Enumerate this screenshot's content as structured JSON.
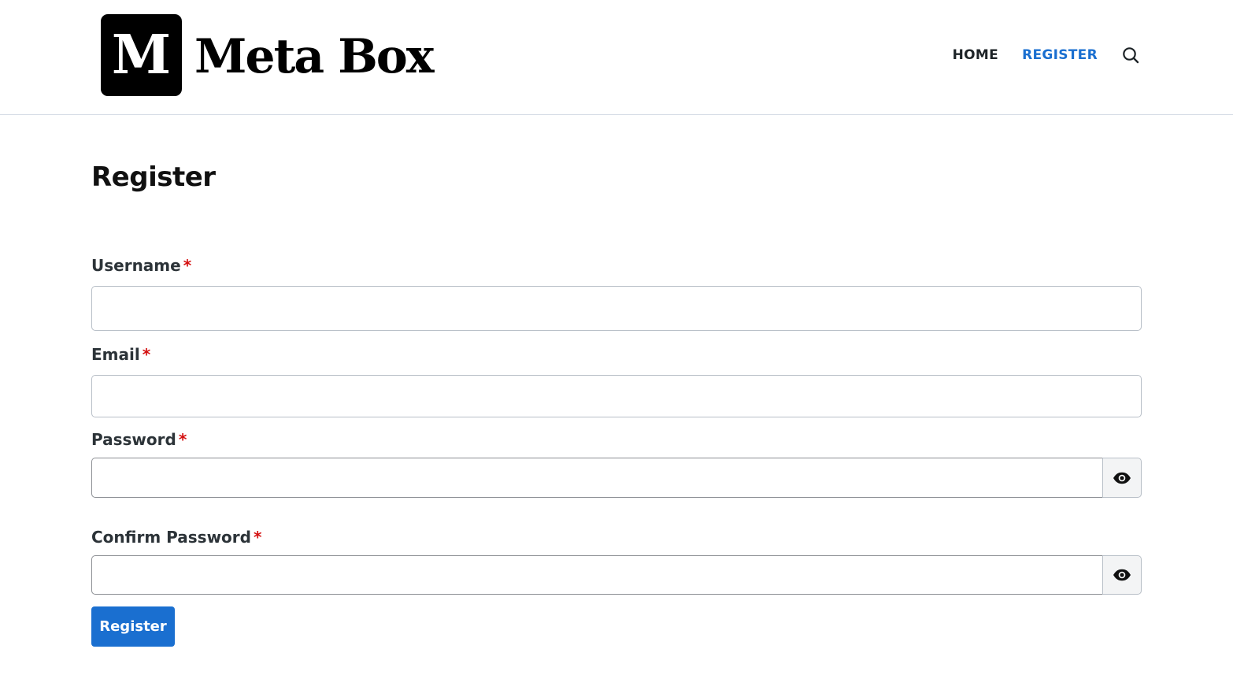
{
  "header": {
    "logo_mark": "M",
    "logo_text": "Meta Box",
    "nav": {
      "home": "HOME",
      "register": "REGISTER"
    },
    "search_icon": "search-icon"
  },
  "main": {
    "title": "Register",
    "fields": {
      "username": {
        "label": "Username",
        "required_mark": "*",
        "value": ""
      },
      "email": {
        "label": "Email",
        "required_mark": "*",
        "value": ""
      },
      "password": {
        "label": "Password",
        "required_mark": "*",
        "value": "",
        "toggle_icon": "eye-icon"
      },
      "confirm_password": {
        "label": "Confirm Password",
        "required_mark": "*",
        "value": "",
        "toggle_icon": "eye-icon"
      }
    },
    "submit_label": "Register"
  },
  "colors": {
    "accent": "#1a6fd0",
    "required": "#d40f0f",
    "text": "#1d2327"
  }
}
